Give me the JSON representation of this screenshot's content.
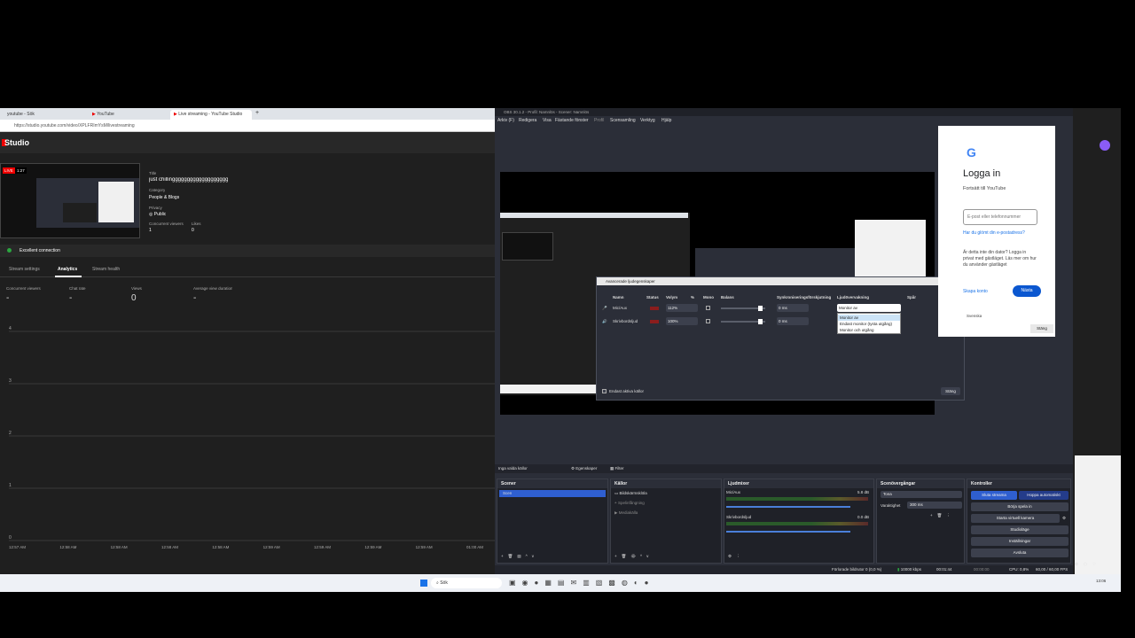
{
  "browser": {
    "tabs": [
      "youtube - Sök",
      "YouTube",
      "Live streaming - YouTube Studio"
    ],
    "url": "https://studio.youtube.com/video/XPLFRImYsM/livestreaming",
    "studio_title": "Studio",
    "live_badge": "LIVE",
    "live_time": "1:27",
    "title_label": "Title",
    "title_value": "just chillinggggggggggggggggggg",
    "category_label": "Category",
    "category_value": "People & Blogs",
    "privacy_label": "Privacy",
    "privacy_value": "Public",
    "viewers_label": "Concurrent viewers",
    "viewers_value": "1",
    "likes_label": "Likes",
    "likes_value": "0",
    "connection": "Excellent connection",
    "tabs2": [
      "Stream settings",
      "Analytics",
      "Stream health"
    ],
    "stats": [
      {
        "label": "Concurrent viewers",
        "value": "-"
      },
      {
        "label": "Chat rate",
        "value": "-"
      },
      {
        "label": "Views",
        "value": "0"
      },
      {
        "label": "Average view duration",
        "value": "-"
      }
    ],
    "chart_data": {
      "type": "line",
      "title": "",
      "ylim": [
        0,
        4
      ],
      "y_ticks": [
        "4",
        "3",
        "2",
        "1",
        "0"
      ],
      "x_ticks": [
        "12:57 AM",
        "12:58 AM",
        "12:58 AM",
        "12:58 AM",
        "12:58 AM",
        "12:59 AM",
        "12:59 AM",
        "12:59 AM",
        "12:59 AM",
        "01:00 AM"
      ],
      "series": []
    }
  },
  "obs": {
    "title": "OBS 30.1.2 - Profil: Namnlös - Scener: Namnlös",
    "menu": [
      "Arkiv (F)",
      "Redigera",
      "Visa",
      "Fästande fönster",
      "Profil",
      "Scensamling",
      "Verktyg",
      "Hjälp"
    ],
    "no_source": "Inga valda källor",
    "props": "Egenskaper",
    "filters": "Filter",
    "scenes_title": "Scener",
    "scene_item": "Scen",
    "sources_title": "Källor",
    "sources": [
      "Bildskärmsklöla",
      "Spelinfångning",
      "Mediakälla"
    ],
    "mixer_title": "Ljudmixer",
    "mixer": [
      {
        "name": "Mic/Aux",
        "db": "5.8 dB"
      },
      {
        "name": "Skrivbordsljud",
        "db": "0.0 dB"
      }
    ],
    "transitions_title": "Scenövergångar",
    "transition_value": "Tona",
    "duration_label": "Varaktighet",
    "duration_value": "300 ms",
    "controls_title": "Kontroller",
    "controls": [
      "Sluta streama",
      "Börja spela in",
      "Starta virtuell kamera",
      "Studioläge",
      "Inställningar",
      "Avsluta"
    ],
    "auto_label": "Hoppa automatiskt",
    "status": "Förlorade bildrutor 0 (0,0 %)",
    "bitrate": "10000 kbps",
    "time1": "00:01:44",
    "time2": "00:00:00",
    "cpu": "CPU: 0,8%",
    "fps": "60,00 / 60,00 FPS"
  },
  "dialog": {
    "title": "Avancerade ljudegenskaper",
    "headers": [
      "Namn",
      "Status",
      "Volym",
      "%",
      "Mono",
      "Balans",
      "Synkroniseringsförskjutning",
      "Ljudövervakning",
      "Spår"
    ],
    "rows": [
      {
        "name": "Mic/Aux",
        "vol": "112%",
        "sync": "0 ms",
        "monitor": "Monitor av"
      },
      {
        "name": "Skrivbordsljud",
        "vol": "100%",
        "sync": "0 ms",
        "monitor": ""
      }
    ],
    "dropdown": [
      "Monitor av",
      "Endast monitor (tysta utgång)",
      "Monitor och utgång"
    ],
    "only_active": "Endast aktiva källor",
    "close": "Stäng"
  },
  "google": {
    "title": "Logga in",
    "subtitle": "Fortsätt till YouTube",
    "placeholder": "E-post eller telefonnummer",
    "forgot": "Har du glömt din e-postadress?",
    "info": "Är detta inte din dator? Logga in privat med gästläget. Läs mer om hur du använder gästläget",
    "create": "Skapa konto",
    "next": "Nästa",
    "close": "Stäng",
    "lang": "Svenska",
    "footer": [
      "Hjälp",
      "Integritet",
      "Villkor"
    ]
  },
  "taskbar": {
    "search": "Sök",
    "clock": "13:06"
  }
}
